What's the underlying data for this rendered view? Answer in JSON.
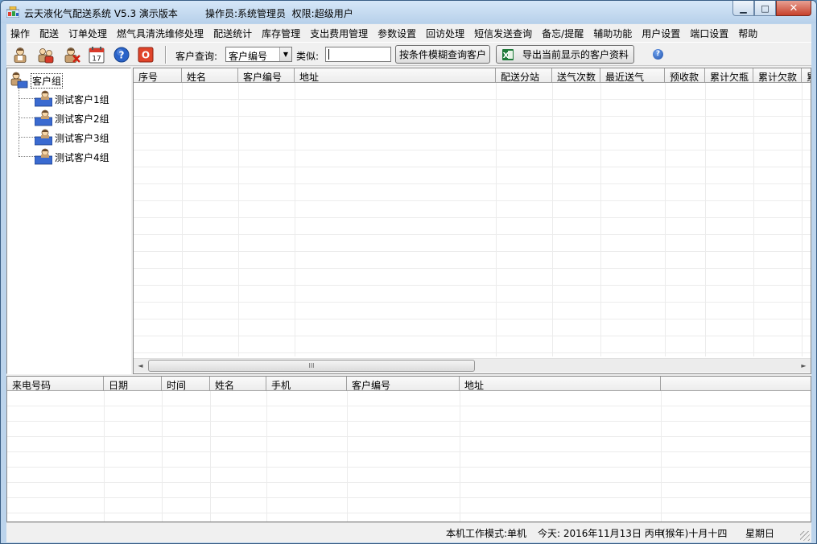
{
  "window": {
    "title": "云天液化气配送系统 V5.3 演示版本",
    "operator": "操作员:系统管理员  权限:超级用户",
    "minimize_glyph": "▁",
    "maximize_glyph": "□",
    "close_glyph": "✕"
  },
  "menu": [
    "操作",
    "配送",
    "订单处理",
    "燃气具清洗维修处理",
    "配送统计",
    "库存管理",
    "支出费用管理",
    "参数设置",
    "回访处理",
    "短信发送查询",
    "备忘/提醒",
    "辅助功能",
    "用户设置",
    "端口设置",
    "帮助"
  ],
  "toolbar": {
    "icons": [
      "user-icon",
      "users-icon",
      "delete-user-icon",
      "calendar-icon",
      "help-icon",
      "exit-icon"
    ],
    "calendar_day": "17",
    "query_label": "客户查询:",
    "query_field": "客户编号",
    "like_label": "类似:",
    "like_value": "",
    "search_button": "按条件模糊查询客户",
    "export_button": "导出当前显示的客户资料",
    "help_glyph": "?",
    "exit_glyph": "O",
    "combo_arrow": "▼",
    "excel_glyph": "X"
  },
  "tree": {
    "root": "客户组",
    "children": [
      "测试客户1组",
      "测试客户2组",
      "测试客户3组",
      "测试客户4组"
    ]
  },
  "customer_grid": {
    "columns": [
      "序号",
      "姓名",
      "客户编号",
      "地址",
      "配送分站",
      "送气次数",
      "最近送气",
      "预收款",
      "累计欠瓶",
      "累计欠款",
      "累"
    ]
  },
  "scrollbar": {
    "left": "◄",
    "right": "►",
    "grip": "III"
  },
  "call_grid": {
    "columns": [
      "来电号码",
      "日期",
      "时间",
      "姓名",
      "手机",
      "客户编号",
      "地址",
      ""
    ]
  },
  "status": {
    "mode": "本机工作模式:单机",
    "today": "今天: 2016年11月13日  丙申",
    "lunar": "(猴年)十月十四",
    "weekday": "星期日"
  }
}
